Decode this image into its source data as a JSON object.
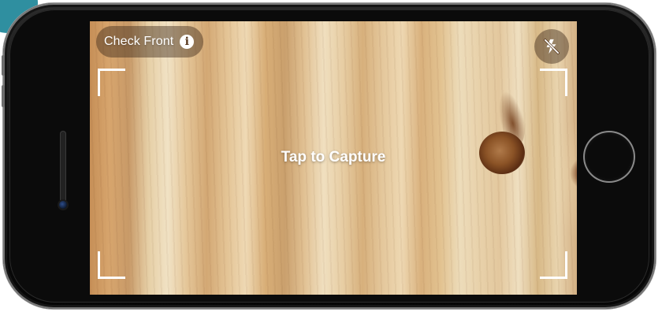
{
  "camera": {
    "mode_label": "Check Front",
    "info_icon_glyph": "i",
    "instruction": "Tap to Capture",
    "flash_state": "off"
  },
  "icons": {
    "info": "info-icon",
    "flash": "flash-off-icon"
  },
  "colors": {
    "accent": "#2f8fa0",
    "overlay": "rgba(60,40,25,0.45)",
    "text": "#ffffff"
  }
}
